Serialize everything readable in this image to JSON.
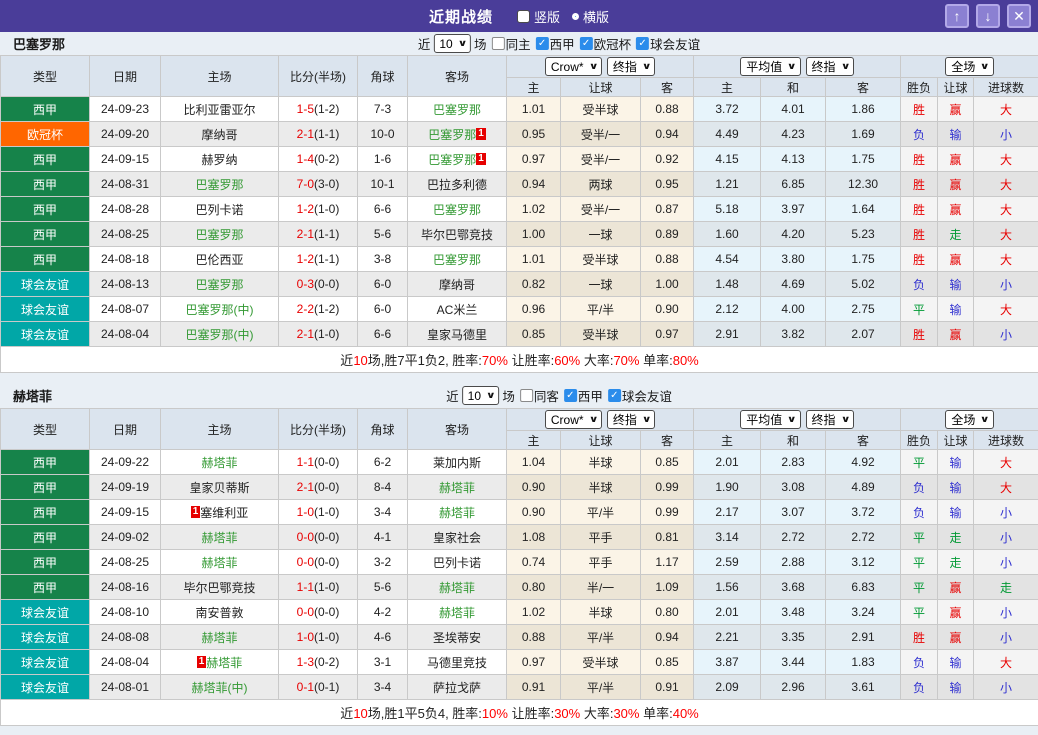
{
  "icons": {
    "caret": "∨",
    "check": "✓"
  },
  "title_bar": {
    "title": "近期战绩",
    "view_options": [
      {
        "label": "竖版",
        "selected": true
      },
      {
        "label": "横版",
        "selected": false
      }
    ],
    "buttons": {
      "up": "↑",
      "down": "↓",
      "close": "✕"
    }
  },
  "table_header": {
    "type": "类型",
    "date": "日期",
    "home": "主场",
    "score": "比分(半场)",
    "corner": "角球",
    "away": "客场",
    "odds_company_select": "Crow*",
    "odds_final_select": "终指",
    "avg_select": "平均值",
    "avg_final_select": "终指",
    "scope_select": "全场",
    "sub": [
      "主",
      "让球",
      "客",
      "主",
      "和",
      "客",
      "胜负",
      "让球",
      "进球数"
    ]
  },
  "sections": [
    {
      "team": "巴塞罗那",
      "filter": {
        "near_label": "近",
        "count": "10",
        "games_label": "场",
        "checkboxes": [
          {
            "label": "同主",
            "checked": false
          },
          {
            "label": "西甲",
            "checked": true
          },
          {
            "label": "欧冠杯",
            "checked": true
          },
          {
            "label": "球会友谊",
            "checked": true
          }
        ]
      },
      "rows": [
        {
          "league": "西甲",
          "lk": "liga",
          "date": "24-09-23",
          "home": {
            "n": "比利亚雷亚尔",
            "f": false
          },
          "away": {
            "n": "巴塞罗那",
            "f": true
          },
          "ft": "1-5",
          "ht": "(1-2)",
          "corner": "7-3",
          "odds": [
            "1.01",
            "受半球",
            "0.88"
          ],
          "avg": [
            "3.72",
            "4.01",
            "1.86"
          ],
          "res": [
            [
              "胜",
              "red"
            ],
            [
              "赢",
              "red"
            ],
            [
              "大",
              "red"
            ]
          ]
        },
        {
          "league": "欧冠杯",
          "lk": "cup",
          "date": "24-09-20",
          "home": {
            "n": "摩纳哥",
            "f": false
          },
          "away": {
            "n": "巴塞罗那",
            "f": true,
            "badge": "1",
            "bpos": "after"
          },
          "ft": "2-1",
          "ht": "(1-1)",
          "corner": "10-0",
          "odds": [
            "0.95",
            "受半/一",
            "0.94"
          ],
          "avg": [
            "4.49",
            "4.23",
            "1.69"
          ],
          "res": [
            [
              "负",
              "blue"
            ],
            [
              "输",
              "blue"
            ],
            [
              "小",
              "blue"
            ]
          ]
        },
        {
          "league": "西甲",
          "lk": "liga",
          "date": "24-09-15",
          "home": {
            "n": "赫罗纳",
            "f": false
          },
          "away": {
            "n": "巴塞罗那",
            "f": true,
            "badge": "1",
            "bpos": "after"
          },
          "ft": "1-4",
          "ht": "(0-2)",
          "corner": "1-6",
          "odds": [
            "0.97",
            "受半/一",
            "0.92"
          ],
          "avg": [
            "4.15",
            "4.13",
            "1.75"
          ],
          "res": [
            [
              "胜",
              "red"
            ],
            [
              "赢",
              "red"
            ],
            [
              "大",
              "red"
            ]
          ]
        },
        {
          "league": "西甲",
          "lk": "liga",
          "date": "24-08-31",
          "home": {
            "n": "巴塞罗那",
            "f": true
          },
          "away": {
            "n": "巴拉多利德",
            "f": false
          },
          "ft": "7-0",
          "ht": "(3-0)",
          "corner": "10-1",
          "odds": [
            "0.94",
            "两球",
            "0.95"
          ],
          "avg": [
            "1.21",
            "6.85",
            "12.30"
          ],
          "res": [
            [
              "胜",
              "red"
            ],
            [
              "赢",
              "red"
            ],
            [
              "大",
              "red"
            ]
          ]
        },
        {
          "league": "西甲",
          "lk": "liga",
          "date": "24-08-28",
          "home": {
            "n": "巴列卡诺",
            "f": false
          },
          "away": {
            "n": "巴塞罗那",
            "f": true
          },
          "ft": "1-2",
          "ht": "(1-0)",
          "corner": "6-6",
          "odds": [
            "1.02",
            "受半/一",
            "0.87"
          ],
          "avg": [
            "5.18",
            "3.97",
            "1.64"
          ],
          "res": [
            [
              "胜",
              "red"
            ],
            [
              "赢",
              "red"
            ],
            [
              "大",
              "red"
            ]
          ]
        },
        {
          "league": "西甲",
          "lk": "liga",
          "date": "24-08-25",
          "home": {
            "n": "巴塞罗那",
            "f": true
          },
          "away": {
            "n": "毕尔巴鄂竞技",
            "f": false
          },
          "ft": "2-1",
          "ht": "(1-1)",
          "corner": "5-6",
          "odds": [
            "1.00",
            "一球",
            "0.89"
          ],
          "avg": [
            "1.60",
            "4.20",
            "5.23"
          ],
          "res": [
            [
              "胜",
              "red"
            ],
            [
              "走",
              "green"
            ],
            [
              "大",
              "red"
            ]
          ]
        },
        {
          "league": "西甲",
          "lk": "liga",
          "date": "24-08-18",
          "home": {
            "n": "巴伦西亚",
            "f": false
          },
          "away": {
            "n": "巴塞罗那",
            "f": true
          },
          "ft": "1-2",
          "ht": "(1-1)",
          "corner": "3-8",
          "odds": [
            "1.01",
            "受半球",
            "0.88"
          ],
          "avg": [
            "4.54",
            "3.80",
            "1.75"
          ],
          "res": [
            [
              "胜",
              "red"
            ],
            [
              "赢",
              "red"
            ],
            [
              "大",
              "red"
            ]
          ]
        },
        {
          "league": "球会友谊",
          "lk": "friendly",
          "date": "24-08-13",
          "home": {
            "n": "巴塞罗那",
            "f": true
          },
          "away": {
            "n": "摩纳哥",
            "f": false
          },
          "ft": "0-3",
          "ht": "(0-0)",
          "corner": "6-0",
          "odds": [
            "0.82",
            "一球",
            "1.00"
          ],
          "avg": [
            "1.48",
            "4.69",
            "5.02"
          ],
          "res": [
            [
              "负",
              "blue"
            ],
            [
              "输",
              "blue"
            ],
            [
              "小",
              "blue"
            ]
          ]
        },
        {
          "league": "球会友谊",
          "lk": "friendly",
          "date": "24-08-07",
          "home": {
            "n": "巴塞罗那(中)",
            "f": true
          },
          "away": {
            "n": "AC米兰",
            "f": false
          },
          "ft": "2-2",
          "ht": "(1-2)",
          "corner": "6-0",
          "odds": [
            "0.96",
            "平/半",
            "0.90"
          ],
          "avg": [
            "2.12",
            "4.00",
            "2.75"
          ],
          "res": [
            [
              "平",
              "green"
            ],
            [
              "输",
              "blue"
            ],
            [
              "大",
              "red"
            ]
          ]
        },
        {
          "league": "球会友谊",
          "lk": "friendly",
          "date": "24-08-04",
          "home": {
            "n": "巴塞罗那(中)",
            "f": true
          },
          "away": {
            "n": "皇家马德里",
            "f": false
          },
          "ft": "2-1",
          "ht": "(1-0)",
          "corner": "6-6",
          "odds": [
            "0.85",
            "受半球",
            "0.97"
          ],
          "avg": [
            "2.91",
            "3.82",
            "2.07"
          ],
          "res": [
            [
              "胜",
              "red"
            ],
            [
              "赢",
              "red"
            ],
            [
              "小",
              "blue"
            ]
          ]
        }
      ],
      "summary": [
        {
          "text": "近",
          "red": false
        },
        {
          "text": "10",
          "red": true
        },
        {
          "text": "场,胜7平1负2, 胜率:",
          "red": false
        },
        {
          "text": "70%",
          "red": true
        },
        {
          "text": " 让胜率:",
          "red": false
        },
        {
          "text": "60%",
          "red": true
        },
        {
          "text": " 大率:",
          "red": false
        },
        {
          "text": "70%",
          "red": true
        },
        {
          "text": " 单率:",
          "red": false
        },
        {
          "text": "80%",
          "red": true
        }
      ]
    },
    {
      "team": "赫塔菲",
      "filter": {
        "near_label": "近",
        "count": "10",
        "games_label": "场",
        "checkboxes": [
          {
            "label": "同客",
            "checked": false
          },
          {
            "label": "西甲",
            "checked": true
          },
          {
            "label": "球会友谊",
            "checked": true
          }
        ]
      },
      "rows": [
        {
          "league": "西甲",
          "lk": "liga",
          "date": "24-09-22",
          "home": {
            "n": "赫塔菲",
            "f": true
          },
          "away": {
            "n": "莱加内斯",
            "f": false
          },
          "ft": "1-1",
          "ht": "(0-0)",
          "corner": "6-2",
          "odds": [
            "1.04",
            "半球",
            "0.85"
          ],
          "avg": [
            "2.01",
            "2.83",
            "4.92"
          ],
          "res": [
            [
              "平",
              "green"
            ],
            [
              "输",
              "blue"
            ],
            [
              "大",
              "red"
            ]
          ]
        },
        {
          "league": "西甲",
          "lk": "liga",
          "date": "24-09-19",
          "home": {
            "n": "皇家贝蒂斯",
            "f": false
          },
          "away": {
            "n": "赫塔菲",
            "f": true
          },
          "ft": "2-1",
          "ht": "(0-0)",
          "corner": "8-4",
          "odds": [
            "0.90",
            "半球",
            "0.99"
          ],
          "avg": [
            "1.90",
            "3.08",
            "4.89"
          ],
          "res": [
            [
              "负",
              "blue"
            ],
            [
              "输",
              "blue"
            ],
            [
              "大",
              "red"
            ]
          ]
        },
        {
          "league": "西甲",
          "lk": "liga",
          "date": "24-09-15",
          "home": {
            "n": "塞维利亚",
            "f": false,
            "badge": "1",
            "bpos": "before"
          },
          "away": {
            "n": "赫塔菲",
            "f": true
          },
          "ft": "1-0",
          "ht": "(1-0)",
          "corner": "3-4",
          "odds": [
            "0.90",
            "平/半",
            "0.99"
          ],
          "avg": [
            "2.17",
            "3.07",
            "3.72"
          ],
          "res": [
            [
              "负",
              "blue"
            ],
            [
              "输",
              "blue"
            ],
            [
              "小",
              "blue"
            ]
          ]
        },
        {
          "league": "西甲",
          "lk": "liga",
          "date": "24-09-02",
          "home": {
            "n": "赫塔菲",
            "f": true
          },
          "away": {
            "n": "皇家社会",
            "f": false
          },
          "ft": "0-0",
          "ht": "(0-0)",
          "corner": "4-1",
          "odds": [
            "1.08",
            "平手",
            "0.81"
          ],
          "avg": [
            "3.14",
            "2.72",
            "2.72"
          ],
          "res": [
            [
              "平",
              "green"
            ],
            [
              "走",
              "green"
            ],
            [
              "小",
              "blue"
            ]
          ]
        },
        {
          "league": "西甲",
          "lk": "liga",
          "date": "24-08-25",
          "home": {
            "n": "赫塔菲",
            "f": true
          },
          "away": {
            "n": "巴列卡诺",
            "f": false
          },
          "ft": "0-0",
          "ht": "(0-0)",
          "corner": "3-2",
          "odds": [
            "0.74",
            "平手",
            "1.17"
          ],
          "avg": [
            "2.59",
            "2.88",
            "3.12"
          ],
          "res": [
            [
              "平",
              "green"
            ],
            [
              "走",
              "green"
            ],
            [
              "小",
              "blue"
            ]
          ]
        },
        {
          "league": "西甲",
          "lk": "liga",
          "date": "24-08-16",
          "home": {
            "n": "毕尔巴鄂竞技",
            "f": false
          },
          "away": {
            "n": "赫塔菲",
            "f": true
          },
          "ft": "1-1",
          "ht": "(1-0)",
          "corner": "5-6",
          "odds": [
            "0.80",
            "半/一",
            "1.09"
          ],
          "avg": [
            "1.56",
            "3.68",
            "6.83"
          ],
          "res": [
            [
              "平",
              "green"
            ],
            [
              "赢",
              "red"
            ],
            [
              "走",
              "green"
            ]
          ]
        },
        {
          "league": "球会友谊",
          "lk": "friendly",
          "date": "24-08-10",
          "home": {
            "n": "南安普敦",
            "f": false
          },
          "away": {
            "n": "赫塔菲",
            "f": true
          },
          "ft": "0-0",
          "ht": "(0-0)",
          "corner": "4-2",
          "odds": [
            "1.02",
            "半球",
            "0.80"
          ],
          "avg": [
            "2.01",
            "3.48",
            "3.24"
          ],
          "res": [
            [
              "平",
              "green"
            ],
            [
              "赢",
              "red"
            ],
            [
              "小",
              "blue"
            ]
          ]
        },
        {
          "league": "球会友谊",
          "lk": "friendly",
          "date": "24-08-08",
          "home": {
            "n": "赫塔菲",
            "f": true
          },
          "away": {
            "n": "圣埃蒂安",
            "f": false
          },
          "ft": "1-0",
          "ht": "(1-0)",
          "corner": "4-6",
          "odds": [
            "0.88",
            "平/半",
            "0.94"
          ],
          "avg": [
            "2.21",
            "3.35",
            "2.91"
          ],
          "res": [
            [
              "胜",
              "red"
            ],
            [
              "赢",
              "red"
            ],
            [
              "小",
              "blue"
            ]
          ]
        },
        {
          "league": "球会友谊",
          "lk": "friendly",
          "date": "24-08-04",
          "home": {
            "n": "赫塔菲",
            "f": true,
            "badge": "1",
            "bpos": "before"
          },
          "away": {
            "n": "马德里竞技",
            "f": false
          },
          "ft": "1-3",
          "ht": "(0-2)",
          "corner": "3-1",
          "odds": [
            "0.97",
            "受半球",
            "0.85"
          ],
          "avg": [
            "3.87",
            "3.44",
            "1.83"
          ],
          "res": [
            [
              "负",
              "blue"
            ],
            [
              "输",
              "blue"
            ],
            [
              "大",
              "red"
            ]
          ]
        },
        {
          "league": "球会友谊",
          "lk": "friendly",
          "date": "24-08-01",
          "home": {
            "n": "赫塔菲(中)",
            "f": true
          },
          "away": {
            "n": "萨拉戈萨",
            "f": false
          },
          "ft": "0-1",
          "ht": "(0-1)",
          "corner": "3-4",
          "odds": [
            "0.91",
            "平/半",
            "0.91"
          ],
          "avg": [
            "2.09",
            "2.96",
            "3.61"
          ],
          "res": [
            [
              "负",
              "blue"
            ],
            [
              "输",
              "blue"
            ],
            [
              "小",
              "blue"
            ]
          ]
        }
      ],
      "summary": [
        {
          "text": "近",
          "red": false
        },
        {
          "text": "10",
          "red": true
        },
        {
          "text": "场,胜1平5负4, 胜率:",
          "red": false
        },
        {
          "text": "10%",
          "red": true
        },
        {
          "text": " 让胜率:",
          "red": false
        },
        {
          "text": "30%",
          "red": true
        },
        {
          "text": " 大率:",
          "red": false
        },
        {
          "text": "30%",
          "red": true
        },
        {
          "text": " 单率:",
          "red": false
        },
        {
          "text": "40%",
          "red": true
        }
      ]
    }
  ]
}
